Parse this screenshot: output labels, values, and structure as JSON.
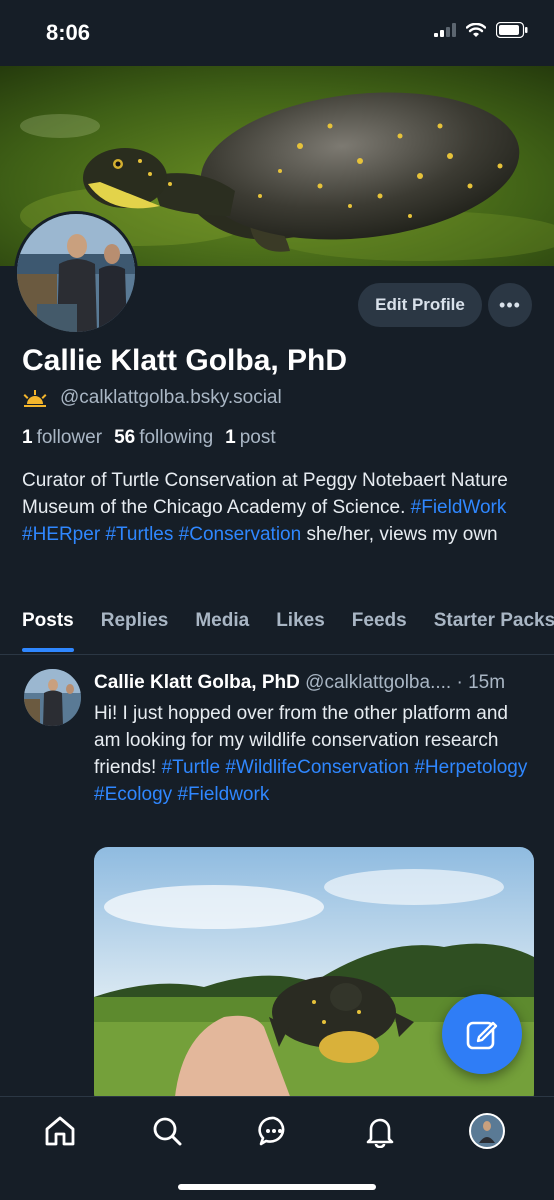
{
  "status_bar": {
    "time": "8:06"
  },
  "profile": {
    "display_name": "Callie Klatt Golba, PhD",
    "handle": "@calklattgolba.bsky.social",
    "edit_button": "Edit Profile",
    "more_button": "•••",
    "stats": {
      "followers_count": "1",
      "followers_label": "follower",
      "following_count": "56",
      "following_label": "following",
      "posts_count": "1",
      "posts_label": "post"
    },
    "bio": {
      "line1": "Curator of Turtle Conservation at Peggy Notebaert Nature Museum of the Chicago Academy of Science.",
      "tags": [
        "#FieldWork",
        "#HERper",
        "#Turtles",
        "#Conservation"
      ],
      "tail": "she/her, views my own"
    }
  },
  "tabs": [
    "Posts",
    "Replies",
    "Media",
    "Likes",
    "Feeds",
    "Starter Packs"
  ],
  "active_tab": "Posts",
  "post": {
    "author": "Callie Klatt Golba, PhD",
    "handle": "@calklattgolba....",
    "time": "· 15m",
    "text": "Hi! I just hopped over from the other platform and am looking for my wildlife conservation research friends!",
    "tags": [
      "#Turtle",
      "#WildlifeConservation",
      "#Herpetology",
      "#Ecology",
      "#Fieldwork"
    ]
  },
  "icons": {
    "status": [
      "signal-icon",
      "wifi-icon",
      "battery-icon"
    ],
    "nav": [
      "home-icon",
      "search-icon",
      "chat-icon",
      "bell-icon",
      "avatar"
    ],
    "fab": "compose-icon"
  },
  "colors": {
    "background": "#161e27",
    "accent": "#2f87ff",
    "secondary_text": "#a9b6c4",
    "button_bg": "#2b3744"
  }
}
